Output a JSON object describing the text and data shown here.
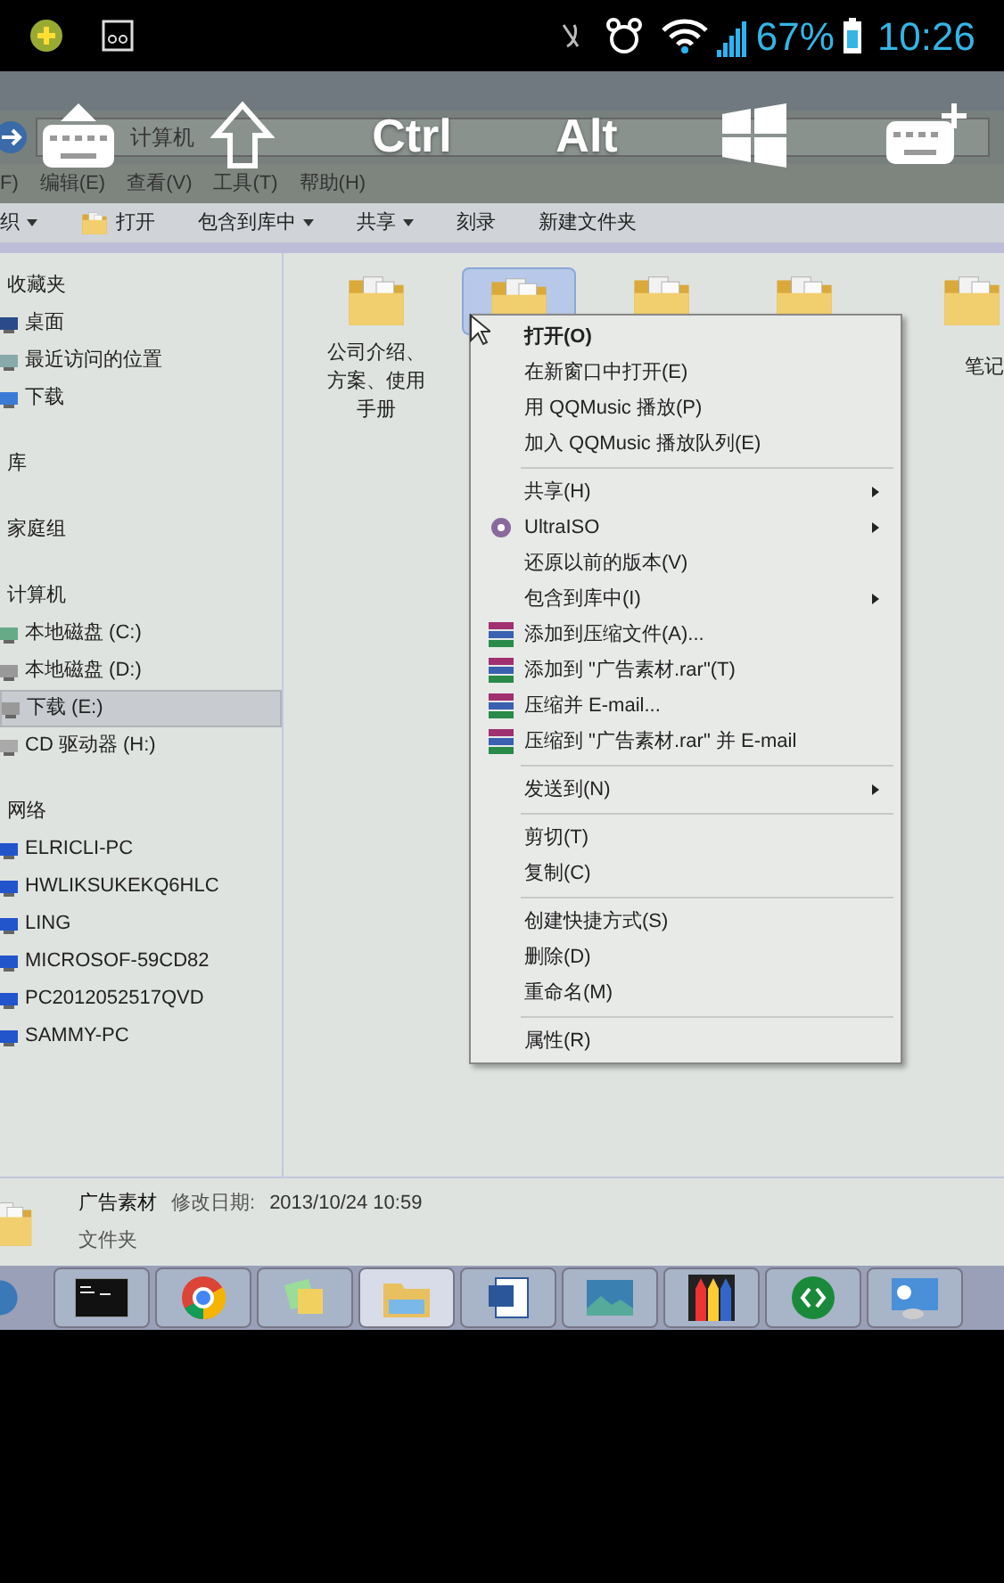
{
  "status_bar": {
    "battery": "67%",
    "time": "10:26"
  },
  "key_bar": {
    "keys": [
      {
        "kind": "keyboard"
      },
      {
        "kind": "shift"
      },
      {
        "kind": "text",
        "label": "Ctrl"
      },
      {
        "kind": "text",
        "label": "Alt"
      },
      {
        "kind": "windows"
      },
      {
        "kind": "keyboard_add"
      }
    ]
  },
  "address_bar": {
    "breadcrumb": [
      "计算机"
    ]
  },
  "menu_bar": [
    "F)",
    "编辑(E)",
    "查看(V)",
    "工具(T)",
    "帮助(H)"
  ],
  "toolbar": [
    {
      "label": "织",
      "dropdown": true,
      "icon": false
    },
    {
      "label": "打开",
      "dropdown": false,
      "icon": true
    },
    {
      "label": "包含到库中",
      "dropdown": true,
      "icon": false
    },
    {
      "label": "共享",
      "dropdown": true,
      "icon": false
    },
    {
      "label": "刻录",
      "dropdown": false,
      "icon": false
    },
    {
      "label": "新建文件夹",
      "dropdown": false,
      "icon": false
    }
  ],
  "nav_pane": [
    {
      "title": "收藏夹",
      "items": [
        {
          "label": "桌面",
          "kind": "desktop",
          "selected": false
        },
        {
          "label": "最近访问的位置",
          "kind": "recent",
          "selected": false
        },
        {
          "label": "下载",
          "kind": "download",
          "selected": false
        }
      ]
    },
    {
      "title": "库"
    },
    {
      "title": "家庭组"
    },
    {
      "title": "计算机",
      "items": [
        {
          "label": "本地磁盘 (C:)",
          "kind": "system_disk",
          "selected": false
        },
        {
          "label": "本地磁盘 (D:)",
          "kind": "disk",
          "selected": false
        },
        {
          "label": "下载 (E:)",
          "kind": "disk",
          "selected": true
        },
        {
          "label": "CD 驱动器 (H:)",
          "kind": "cd",
          "selected": false
        }
      ]
    },
    {
      "title": "网络",
      "items": [
        {
          "label": "ELRICLI-PC",
          "kind": "pc",
          "selected": false
        },
        {
          "label": "HWLIKSUKEKQ6HLC",
          "kind": "pc",
          "selected": false
        },
        {
          "label": "LING",
          "kind": "pc",
          "selected": false
        },
        {
          "label": "MICROSOF-59CD82",
          "kind": "pc",
          "selected": false
        },
        {
          "label": "PC2012052517QVD",
          "kind": "pc",
          "selected": false
        },
        {
          "label": "SAMMY-PC",
          "kind": "pc",
          "selected": false
        }
      ]
    }
  ],
  "files": [
    {
      "label": "公司介绍、方案、使用手册",
      "selected": false
    },
    {
      "selected": true
    },
    {
      "selected": false
    },
    {
      "selected": false
    },
    {
      "label": "笔记",
      "selected": false
    }
  ],
  "context_menu": [
    {
      "kind": "item",
      "label": "打开(O)",
      "default": true,
      "submenu": false
    },
    {
      "kind": "item",
      "label": "在新窗口中打开(E)",
      "default": false,
      "submenu": false
    },
    {
      "kind": "item",
      "label": "用 QQMusic 播放(P)",
      "default": false,
      "submenu": false
    },
    {
      "kind": "item",
      "label": "加入 QQMusic 播放队列(E)",
      "default": false,
      "submenu": false
    },
    {
      "kind": "separator"
    },
    {
      "kind": "item",
      "label": "共享(H)",
      "default": false,
      "submenu": true
    },
    {
      "kind": "disc_item",
      "label": "UltraISO",
      "default": false,
      "submenu": true
    },
    {
      "kind": "item",
      "label": "还原以前的版本(V)",
      "default": false,
      "submenu": false
    },
    {
      "kind": "item",
      "label": "包含到库中(I)",
      "default": false,
      "submenu": true
    },
    {
      "kind": "archive_item",
      "label": "添加到压缩文件(A)...",
      "default": false,
      "submenu": false
    },
    {
      "kind": "archive_item",
      "label": "添加到 \"广告素材.rar\"(T)",
      "default": false,
      "submenu": false
    },
    {
      "kind": "archive_item",
      "label": "压缩并 E-mail...",
      "default": false,
      "submenu": false
    },
    {
      "kind": "archive_item",
      "label": "压缩到 \"广告素材.rar\" 并 E-mail",
      "default": false,
      "submenu": false
    },
    {
      "kind": "separator"
    },
    {
      "kind": "item",
      "label": "发送到(N)",
      "default": false,
      "submenu": true
    },
    {
      "kind": "separator"
    },
    {
      "kind": "item",
      "label": "剪切(T)",
      "default": false,
      "submenu": false
    },
    {
      "kind": "item",
      "label": "复制(C)",
      "default": false,
      "submenu": false
    },
    {
      "kind": "separator"
    },
    {
      "kind": "item",
      "label": "创建快捷方式(S)",
      "default": false,
      "submenu": false
    },
    {
      "kind": "item",
      "label": "删除(D)",
      "default": false,
      "submenu": false
    },
    {
      "kind": "item",
      "label": "重命名(M)",
      "default": false,
      "submenu": false
    },
    {
      "kind": "separator"
    },
    {
      "kind": "item",
      "label": "属性(R)",
      "default": false,
      "submenu": false
    }
  ],
  "details": {
    "name": "广告素材",
    "date_label": "修改日期:",
    "date": "2013/10/24 10:59",
    "type": "文件夹"
  },
  "taskbar": [
    {
      "kind": "cmd",
      "selected": false
    },
    {
      "kind": "chrome",
      "selected": false
    },
    {
      "kind": "notes",
      "selected": false
    },
    {
      "kind": "explorer",
      "selected": true
    },
    {
      "kind": "word",
      "selected": false
    },
    {
      "kind": "photo",
      "selected": false
    },
    {
      "kind": "pencils",
      "selected": false
    },
    {
      "kind": "remote",
      "selected": false
    },
    {
      "kind": "panel",
      "selected": false
    }
  ]
}
